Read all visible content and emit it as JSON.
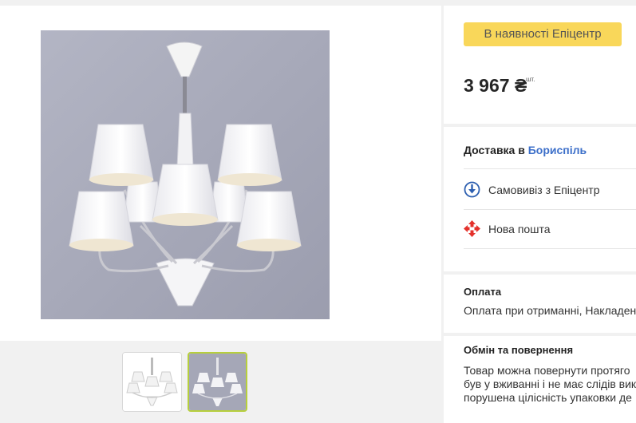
{
  "gallery": {
    "main_image": "chandelier-photo",
    "thumbnails": [
      {
        "image": "chandelier-white-background",
        "selected": false
      },
      {
        "image": "chandelier-gray-background",
        "selected": true
      }
    ]
  },
  "availability_badge": "В наявності Епіцентр",
  "price": {
    "amount": "3 967 ₴",
    "unit": "шт."
  },
  "delivery": {
    "heading_prefix": "Доставка в",
    "city": "Бориспіль",
    "options": [
      {
        "label": "Самовивіз з Епіцентр",
        "icon": "pickup-icon"
      },
      {
        "label": "Нова пошта",
        "icon": "nova-poshta-icon"
      }
    ]
  },
  "payment": {
    "heading": "Оплата",
    "text": "Оплата при отриманні, Накладен"
  },
  "returns": {
    "heading": "Обмін та повернення",
    "lines": [
      "Товар можна повернути протяго",
      "був у вживанні і не має слідів вик",
      "порушена цілісність упаковки де"
    ]
  },
  "colors": {
    "badge_bg": "#f9d75a",
    "city_link": "#3c6fc9",
    "selected_thumb_border": "#b7cf3c",
    "pickup_icon": "#2d5fb0",
    "nova_poshta_icon": "#e4312b"
  }
}
